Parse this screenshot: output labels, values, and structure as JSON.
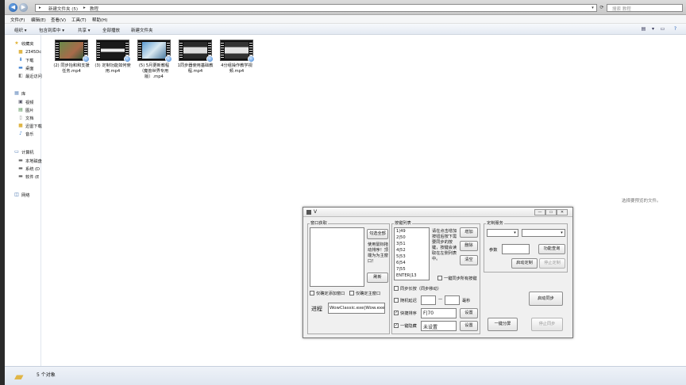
{
  "explorer": {
    "breadcrumb": [
      "新建文件夹 (5)",
      "教程"
    ],
    "search_placeholder": "搜索 教程",
    "menu": [
      "文件(F)",
      "编辑(E)",
      "查看(V)",
      "工具(T)",
      "帮助(H)"
    ],
    "toolbar": [
      "组织 ▾",
      "包含到库中 ▾",
      "共享 ▾",
      "全部播放",
      "新建文件夹"
    ],
    "sidebar": {
      "favorites": "收藏夹",
      "fav_items": [
        "2345Dc",
        "下载",
        "桌面",
        "最近访问"
      ],
      "library": "库",
      "lib_items": [
        "视频",
        "图片",
        "文档",
        "迅雷下载",
        "音乐"
      ],
      "computer": "计算机",
      "comp_items": [
        "本地磁盘",
        "系统 (D",
        "软件 (E"
      ],
      "network": "网络"
    },
    "files": [
      {
        "name": "(2) 同步抬和和支援任务.mp4"
      },
      {
        "name": "(3) 定制功能如何使用.mp4"
      },
      {
        "name": "(5) 5月更新教程（魔兽世界专用版）.mp4"
      },
      {
        "name": "1同步器使用基础教程.mp4"
      },
      {
        "name": "4分组操作教学视频.mp4"
      }
    ],
    "preview_text": "选择要预览的文件。",
    "status": "5 个对象"
  },
  "dialog": {
    "title": "V",
    "window_group": {
      "title": "窗口获取",
      "select_all": "勾选全部",
      "hint": "使用鼠标拖动排序！顶端为为主窗口！",
      "refresh": "刷新",
      "only_add_main": "仅确定添加窗口",
      "only_main": "仅确定主窗口",
      "process_label": "进程",
      "process_value": "WowClassic.exe|Wow.exe"
    },
    "key_group": {
      "title": "按键列表",
      "keys": [
        "1|49",
        "2|50",
        "3|51",
        "4|52",
        "5|53",
        "6|54",
        "7|55",
        "ENTER|13"
      ],
      "hint": "请在点击增加按钮后按下需要同步的按键，按键会读取在左侧列表中。",
      "add": "增加",
      "delete": "删除",
      "clear": "清空",
      "sync_all": "一键同步所有按键",
      "sync_long": "同步长按（同步移动）",
      "random_delay": "随机延迟",
      "dash": "—",
      "ms": "毫秒",
      "hotkey_order": "快捷排序",
      "hotkey_order_value": "F|70",
      "set1": "设置",
      "hide": "一键隐藏",
      "hide_value": "未设置",
      "set2": "设置"
    },
    "custom_group": {
      "title": "定制服务",
      "param_label": "参数",
      "func_query": "功能查询",
      "start_custom": "启动定制",
      "stop_custom": "停止定制"
    },
    "start_sync": "启动同步",
    "split_screen": "一键分屏",
    "stop_sync": "停止同步"
  }
}
